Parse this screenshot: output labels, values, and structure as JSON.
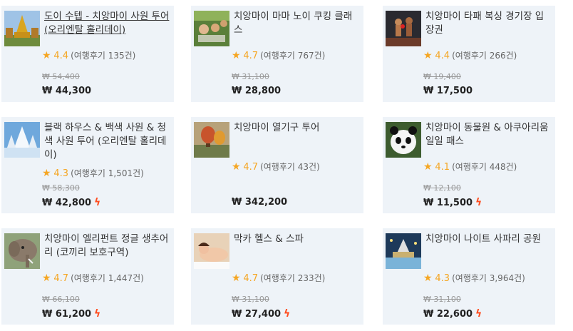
{
  "products": [
    {
      "title": "도이 수텝 - 치앙마이 사원 투어 (오리엔탈 홀리데이)",
      "score": "4.4",
      "reviews": "(여행후기 135건)",
      "old_price": "₩ 54,400",
      "price": "₩ 44,300",
      "instant": false,
      "thumb": "temple-gold"
    },
    {
      "title": "치앙마이 마마 노이 쿠킹 클래스",
      "score": "4.7",
      "reviews": "(여행후기 767건)",
      "old_price": "₩ 31,100",
      "price": "₩ 28,800",
      "instant": false,
      "thumb": "cooking"
    },
    {
      "title": "치앙마이 타패 복싱 경기장 입장권",
      "score": "4.4",
      "reviews": "(여행후기 266건)",
      "old_price": "₩ 19,400",
      "price": "₩ 17,500",
      "instant": false,
      "thumb": "boxing"
    },
    {
      "title": "블랙 하우스 & 백색 사원 & 청색 사원 투어 (오리엔탈 홀리데이)",
      "score": "4.3",
      "reviews": "(여행후기 1,501건)",
      "old_price": "₩ 58,300",
      "price": "₩ 42,800",
      "instant": true,
      "thumb": "white-temple"
    },
    {
      "title": "치앙마이 열기구 투어",
      "score": "4.7",
      "reviews": "(여행후기 43건)",
      "old_price": "",
      "price": "₩ 342,200",
      "instant": false,
      "thumb": "balloon"
    },
    {
      "title": "치앙마이 동물원 & 아쿠아리움 일일 패스",
      "score": "4.1",
      "reviews": "(여행후기 448건)",
      "old_price": "₩ 12,100",
      "price": "₩ 11,500",
      "instant": true,
      "thumb": "panda"
    },
    {
      "title": "치앙마이 엘리펀트 정글 생추어리 (코끼리 보호구역)",
      "score": "4.7",
      "reviews": "(여행후기 1,447건)",
      "old_price": "₩ 66,100",
      "price": "₩ 61,200",
      "instant": true,
      "thumb": "elephant"
    },
    {
      "title": "막카 헬스 & 스파",
      "score": "4.7",
      "reviews": "(여행후기 233건)",
      "old_price": "₩ 31,100",
      "price": "₩ 27,400",
      "instant": true,
      "thumb": "spa"
    },
    {
      "title": "치앙마이 나이트 사파리 공원",
      "score": "4.3",
      "reviews": "(여행후기 3,964건)",
      "old_price": "₩ 31,100",
      "price": "₩ 22,600",
      "instant": true,
      "thumb": "safari"
    }
  ],
  "icons": {
    "star": "star-icon",
    "instant": "lightning-icon"
  },
  "colors": {
    "card_bg": "#eef3f8",
    "star": "#f5a623",
    "instant": "#ff4d1f"
  }
}
